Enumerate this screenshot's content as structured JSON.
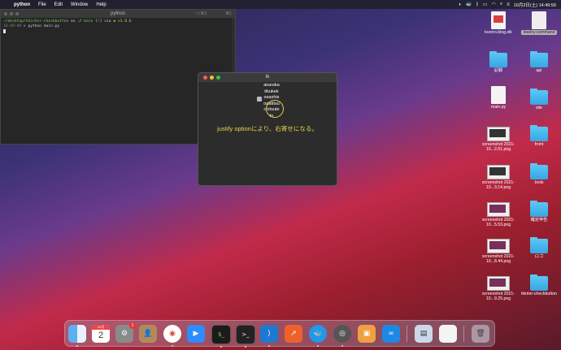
{
  "menubar": {
    "app": "python",
    "items": [
      "File",
      "Edit",
      "Window",
      "Help"
    ],
    "clock": "10月2日(土) 14:49:50"
  },
  "terminal": {
    "title": "python",
    "shortcut1": "⌥⌘2",
    "shortcut2": "⌘1",
    "line1_path": "~/desktop/tkinter-checkbutton",
    "line1_on": " on ",
    "line1_branch": "main",
    "line1_status": " [!] via ",
    "line1_version": "v3.8.6",
    "line2_time": "14:49:49",
    "line2_cmd": " > python main.py"
  },
  "tk": {
    "title": "tk",
    "checkbox_lines": [
      "aiueoka",
      "tikukek",
      "osashis",
      "onatitsu",
      "chitsute",
      "to"
    ],
    "note": "justify optionにより、右寄せになる。",
    "colors": {
      "close": "#ff5f57",
      "min": "#febc2e",
      "max": "#28c840"
    }
  },
  "desktop_icons": [
    {
      "label": "kuroro.blog.xlk",
      "kind": "doc"
    },
    {
      "label": "deploy.command",
      "kind": "doc-exec"
    },
    {
      "label": "記録",
      "kind": "folder"
    },
    {
      "label": "api",
      "kind": "folder"
    },
    {
      "label": "main.py",
      "kind": "doc"
    },
    {
      "label": "site",
      "kind": "folder"
    },
    {
      "label": "screenshot 2021-10...2.01.png",
      "kind": "shot"
    },
    {
      "label": "front",
      "kind": "folder"
    },
    {
      "label": "screenshot 2021-10...3.14.png",
      "kind": "shot"
    },
    {
      "label": "tools",
      "kind": "folder"
    },
    {
      "label": "screenshot 2021-10...5.53.png",
      "kind": "shot-red"
    },
    {
      "label": "確定申告",
      "kind": "folder"
    },
    {
      "label": "screenshot 2021-10...8.44.png",
      "kind": "shot-red"
    },
    {
      "label": "ロゴ",
      "kind": "folder"
    },
    {
      "label": "screenshot 2021-10...9.25.png",
      "kind": "shot-red"
    },
    {
      "label": "tkinter-checkbutton",
      "kind": "folder"
    }
  ],
  "dock": {
    "calendar_day": "2",
    "calendar_month": "10月",
    "settings_badge": "1",
    "apps": [
      "finder",
      "calendar",
      "system-preferences",
      "contacts",
      "chrome",
      "zoom",
      "terminal",
      "terminal-2",
      "vscode",
      "git-app",
      "docker",
      "quicktime",
      "preview",
      "infinity",
      "photos",
      "document",
      "trash"
    ]
  }
}
